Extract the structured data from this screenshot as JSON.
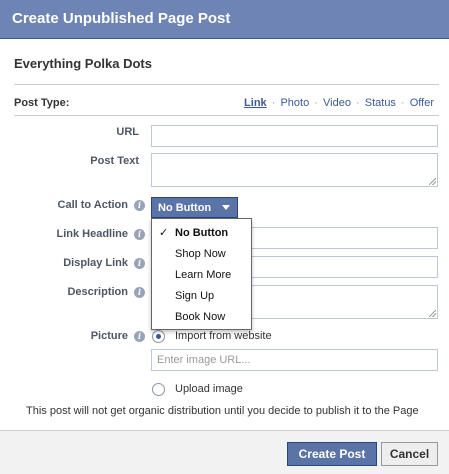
{
  "dialog": {
    "title": "Create Unpublished Page Post",
    "page_name": "Everything Polka Dots"
  },
  "post_type": {
    "label": "Post Type:",
    "options": [
      "Link",
      "Photo",
      "Video",
      "Status",
      "Offer"
    ],
    "selected": "Link",
    "separator": "·"
  },
  "form": {
    "url_label": "URL",
    "post_text_label": "Post Text",
    "cta_label": "Call to Action",
    "link_headline_label": "Link Headline",
    "display_link_label": "Display Link",
    "description_label": "Description",
    "picture_label": "Picture",
    "info_glyph": "i"
  },
  "cta_dropdown": {
    "selected": "No Button",
    "options": [
      "No Button",
      "Shop Now",
      "Learn More",
      "Sign Up",
      "Book Now"
    ],
    "check": "✓"
  },
  "picture": {
    "import_label": "Import from website",
    "import_selected": true,
    "image_url_placeholder": "Enter image URL...",
    "upload_label": "Upload image"
  },
  "notice": "This post will not get organic distribution until you decide to publish it to the Page",
  "footer": {
    "create_label": "Create Post",
    "cancel_label": "Cancel"
  },
  "colors": {
    "brand_blue": "#6d84b4",
    "button_blue": "#5b74a8",
    "link_blue": "#3b5998"
  }
}
